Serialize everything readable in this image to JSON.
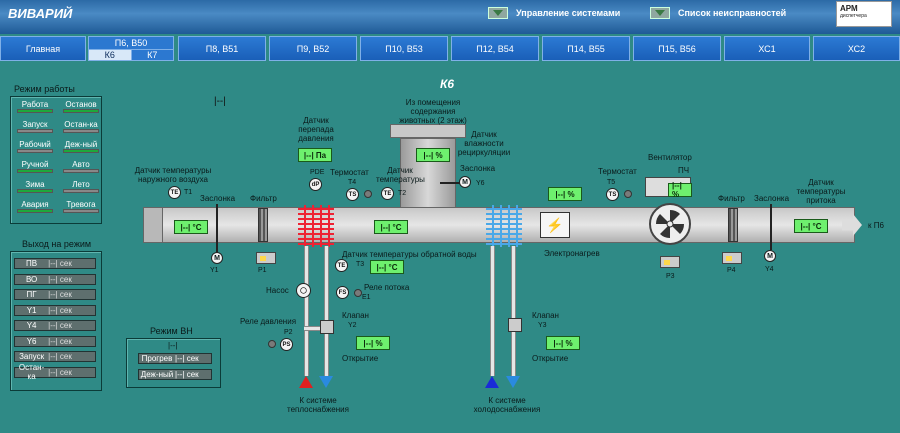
{
  "header": {
    "app_title": "ВИВАРИЙ",
    "btn_systems": "Управление системами",
    "btn_faults": "Список неисправностей",
    "logo_text": "АРМ",
    "logo_sub": "диспетчера"
  },
  "nav": {
    "main": "Главная",
    "p6b50": "П6, В50",
    "k6": "К6",
    "k7": "К7",
    "tabs": [
      "П8, В51",
      "П9, В52",
      "П10, В53",
      "П12, В54",
      "П14, В55",
      "П15, В56",
      "ХС1",
      "ХС2"
    ]
  },
  "mode": {
    "title": "Режим работы",
    "cells": [
      {
        "label": "Работа",
        "on": true
      },
      {
        "label": "Останов",
        "on": true
      },
      {
        "label": "Запуск",
        "on": false
      },
      {
        "label": "Остан-ка",
        "on": false
      },
      {
        "label": "Рабочий",
        "on": false
      },
      {
        "label": "Деж-ный",
        "on": true
      },
      {
        "label": "Ручной",
        "on": true
      },
      {
        "label": "Авто",
        "on": false
      },
      {
        "label": "Зима",
        "on": true
      },
      {
        "label": "Лето",
        "on": false
      },
      {
        "label": "Авария",
        "on": true
      },
      {
        "label": "Тревога",
        "on": false
      }
    ]
  },
  "exit": {
    "title": "Выход на режим",
    "unit": "|--| сек",
    "rows": [
      "ПВ",
      "ВО",
      "ПГ",
      "Y1",
      "Y4",
      "Y6",
      "Запуск",
      "Остан-ка"
    ]
  },
  "vn": {
    "title": "Режим ВН",
    "indicator": "|--|",
    "rows": [
      {
        "label": "Прогрев",
        "value": "|--| сек"
      },
      {
        "label": "Деж-ный",
        "value": "|--| сек"
      }
    ]
  },
  "scheme": {
    "title": "К6",
    "indicator": "|--|",
    "outdoor_temp_label": "Датчик температуры наружного воздуха",
    "damper1": "Заслонка",
    "filter1": "Фильтр",
    "dp_label": "Датчик перепада давления",
    "dp_value": "|--| Па",
    "from_rooms_label": "Из помещения содержания животных (2 этаж)",
    "humidity_value": "|--| %",
    "humidity_label": "Датчик влажности рециркуляции",
    "thermostat1": "Термостат",
    "temp_sensor": "Датчик температуры",
    "damper6": "Заслонка",
    "thermostat2": "Термостат",
    "fan_label": "Вентилятор",
    "fc_label": "ПЧ",
    "fc_value": "|--| %",
    "filter2": "Фильтр",
    "damper2": "Заслонка",
    "supply_temp_label": "Датчик температуры притока",
    "to_p6": "к П6",
    "outdoor_temp_value": "|--| °С",
    "mid_temp_value": "|--| °С",
    "supply_temp_value": "|--| °С",
    "heater_pct": "|--| %",
    "electro_heater": "Электронагрев",
    "return_temp_label": "Датчик температуры обратной воды",
    "return_temp_value": "|--| °С",
    "pump": "Насос",
    "flow_relay": "Реле потока",
    "pressure_relay": "Реле давления",
    "valve": "Клапан",
    "valve2": "Клапан",
    "open1_value": "|--| %",
    "open1_label": "Открытие",
    "open2_value": "|--| %",
    "open2_label": "Открытие",
    "heat_supply": "К системе теплоснабжения",
    "cold_supply": "К системе холодоснабжения",
    "tags": {
      "t1": "T1",
      "t4": "T4",
      "t2": "T2",
      "t5": "T5",
      "t3": "T3",
      "y1": "Y1",
      "y6": "Y6",
      "y4": "Y4",
      "y2": "Y2",
      "y3": "Y3",
      "p1": "P1",
      "p2": "P2",
      "p3": "P3",
      "p4": "P4",
      "e1": "E1",
      "pde": "PDE"
    }
  }
}
